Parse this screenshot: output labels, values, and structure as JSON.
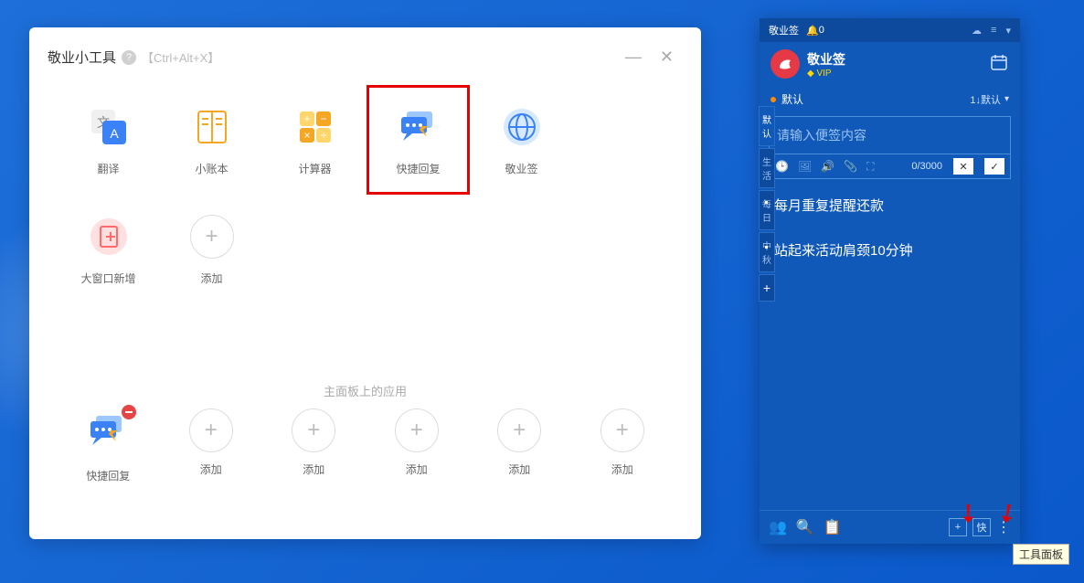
{
  "toolsWindow": {
    "title": "敬业小工具",
    "shortcut": "【Ctrl+Alt+X】",
    "tools": [
      {
        "id": "translate",
        "label": "翻译"
      },
      {
        "id": "ledger",
        "label": "小账本"
      },
      {
        "id": "calculator",
        "label": "计算器"
      },
      {
        "id": "quickreply",
        "label": "快捷回复"
      },
      {
        "id": "jingye",
        "label": "敬业签"
      },
      {
        "id": "bigwindow",
        "label": "大窗口新增"
      },
      {
        "id": "add",
        "label": "添加"
      }
    ],
    "sectionTitle": "主面板上的应用",
    "bottomItems": [
      {
        "id": "quickreply",
        "label": "快捷回复"
      },
      {
        "id": "add",
        "label": "添加"
      },
      {
        "id": "add",
        "label": "添加"
      },
      {
        "id": "add",
        "label": "添加"
      },
      {
        "id": "add",
        "label": "添加"
      },
      {
        "id": "add",
        "label": "添加"
      }
    ]
  },
  "sidebar": {
    "topTitle": "敬业签",
    "bellCount": "0",
    "appName": "敬业签",
    "vip": "VIP",
    "tabs": [
      "默认",
      "生活",
      "每日",
      "中秋"
    ],
    "listName": "默认",
    "sortLabel": "1↓默认",
    "inputPlaceholder": "请输入便签内容",
    "counter": "0/3000",
    "notes": [
      "每月重复提醒还款",
      "站起来活动肩颈10分钟"
    ],
    "footerQuick": "快"
  },
  "tooltip": "工具面板"
}
